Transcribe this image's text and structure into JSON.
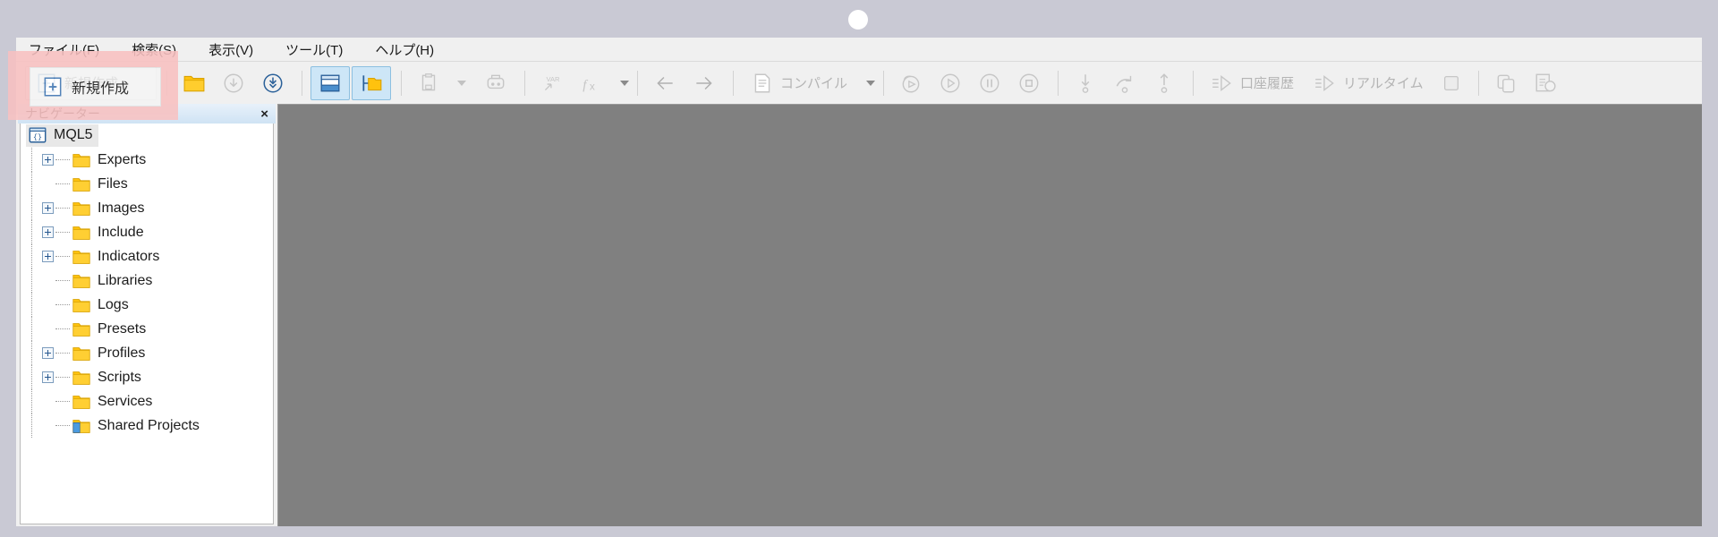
{
  "window": {
    "title_dot": "window-dot"
  },
  "menubar": {
    "items": [
      {
        "label": "ファイル(F)",
        "name": "menu-file"
      },
      {
        "label": "検索(S)",
        "name": "menu-search"
      },
      {
        "label": "表示(V)",
        "name": "menu-view"
      },
      {
        "label": "ツール(T)",
        "name": "menu-tools"
      },
      {
        "label": "ヘルプ(H)",
        "name": "menu-help"
      }
    ]
  },
  "toolbar": {
    "new_label": "新規作成",
    "compile_label": "コンパイル",
    "account_history_label": "口座履歴",
    "realtime_label": "リアルタイム",
    "icons": {
      "new": "new-file-icon",
      "open": "open-folder-icon",
      "save": "save-icon",
      "save_all": "save-all-icon",
      "toggle_panel": "toggle-panel-icon",
      "toggle_navigator": "toggle-navigator-icon",
      "clipboard": "clipboard-icon",
      "print": "print-icon",
      "variable": "variable-icon",
      "function": "function-icon",
      "back": "arrow-left-icon",
      "forward": "arrow-right-icon",
      "compile": "compile-icon",
      "debug_history": "debug-history-icon",
      "debug_run": "debug-run-icon",
      "debug_pause": "debug-pause-icon",
      "debug_stop": "debug-stop-icon",
      "step_into": "step-into-icon",
      "step_over": "step-over-icon",
      "step_out": "step-out-icon",
      "account_history": "account-history-icon",
      "realtime": "realtime-icon",
      "stop_square": "stop-square-icon",
      "copy": "copy-icon",
      "properties": "properties-icon"
    }
  },
  "navigator": {
    "title": "ナビゲーター",
    "close_label": "×",
    "tree": [
      {
        "label": "MQL5",
        "level": 0,
        "expander": "none",
        "icon": "mql5-root-icon",
        "selected": true
      },
      {
        "label": "Experts",
        "level": 1,
        "expander": "collapsed",
        "icon": "folder-icon",
        "selected": false
      },
      {
        "label": "Files",
        "level": 1,
        "expander": "none",
        "icon": "folder-icon",
        "selected": false
      },
      {
        "label": "Images",
        "level": 1,
        "expander": "collapsed",
        "icon": "folder-icon",
        "selected": false
      },
      {
        "label": "Include",
        "level": 1,
        "expander": "collapsed",
        "icon": "folder-icon",
        "selected": false
      },
      {
        "label": "Indicators",
        "level": 1,
        "expander": "collapsed",
        "icon": "folder-icon",
        "selected": false
      },
      {
        "label": "Libraries",
        "level": 1,
        "expander": "none",
        "icon": "folder-icon",
        "selected": false
      },
      {
        "label": "Logs",
        "level": 1,
        "expander": "none",
        "icon": "folder-icon",
        "selected": false
      },
      {
        "label": "Presets",
        "level": 1,
        "expander": "none",
        "icon": "folder-icon",
        "selected": false
      },
      {
        "label": "Profiles",
        "level": 1,
        "expander": "collapsed",
        "icon": "folder-icon",
        "selected": false
      },
      {
        "label": "Scripts",
        "level": 1,
        "expander": "collapsed",
        "icon": "folder-icon",
        "selected": false
      },
      {
        "label": "Services",
        "level": 1,
        "expander": "none",
        "icon": "folder-icon",
        "selected": false
      },
      {
        "label": "Shared Projects",
        "level": 1,
        "expander": "none",
        "icon": "shared-folder-icon",
        "selected": false
      }
    ]
  },
  "annotation": {
    "highlight_label": "新規作成",
    "highlight_color": "#f8c1c1"
  },
  "colors": {
    "desktop": "#c9c9d4",
    "chrome": "#f0f0f0",
    "workspace": "#808080",
    "folder": "#ffc20e",
    "accent_blue": "#2a6099",
    "checked_button": "#cde6f7"
  }
}
